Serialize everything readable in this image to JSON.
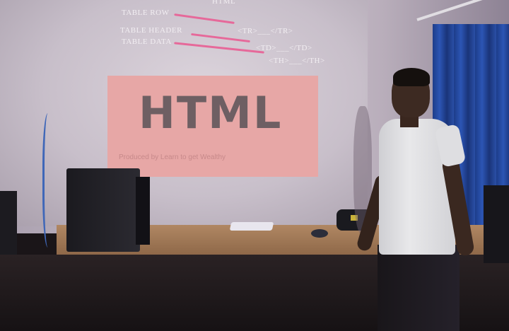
{
  "slide": {
    "header_fragment": "HTML",
    "rows": [
      {
        "label": "TABLE ROW",
        "tag": "<TR>___</TR>"
      },
      {
        "label": "TABLE HEADER",
        "tag": "<TH>___</TH>"
      },
      {
        "label": "TABLE DATA",
        "tag": "<TD>___</TD>"
      }
    ],
    "banner_title": "HTML",
    "banner_subtitle": "Produced by Learn to get Wealthy"
  },
  "colors": {
    "slide_arrow": "#e6699a",
    "banner_bg": "#e7a7a6",
    "curtain": "#2c55b4"
  }
}
